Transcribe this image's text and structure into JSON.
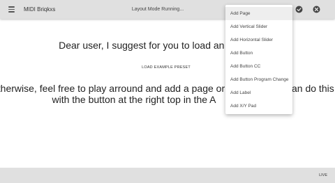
{
  "appbar": {
    "title": "MIDI Briqkxs",
    "status": "Layout Mode Running..."
  },
  "main": {
    "line1": "Dear user, I suggest for you to load an exa",
    "load_button": "LOAD EXAMPLE PRESET",
    "line2": "Otherwise, feel free to play arround and add a page or",
    "line2_end": "an do this",
    "line3": "with the button at the right top in the A"
  },
  "add_menu": {
    "items": [
      "Add Page",
      "Add Vertical Slider",
      "Add Horizontal Slider",
      "Add Button",
      "Add Button CC",
      "Add Button Program Change",
      "Add Label",
      "Add X/Y Pad"
    ]
  },
  "bottombar": {
    "live": "LIVE"
  },
  "icons": {
    "menu": "hamburger-menu-icon",
    "confirm": "check-circle-icon",
    "close": "close-circle-icon"
  },
  "colors": {
    "bars": "#e0e0e0",
    "menu_highlight": "#eeeeee"
  }
}
